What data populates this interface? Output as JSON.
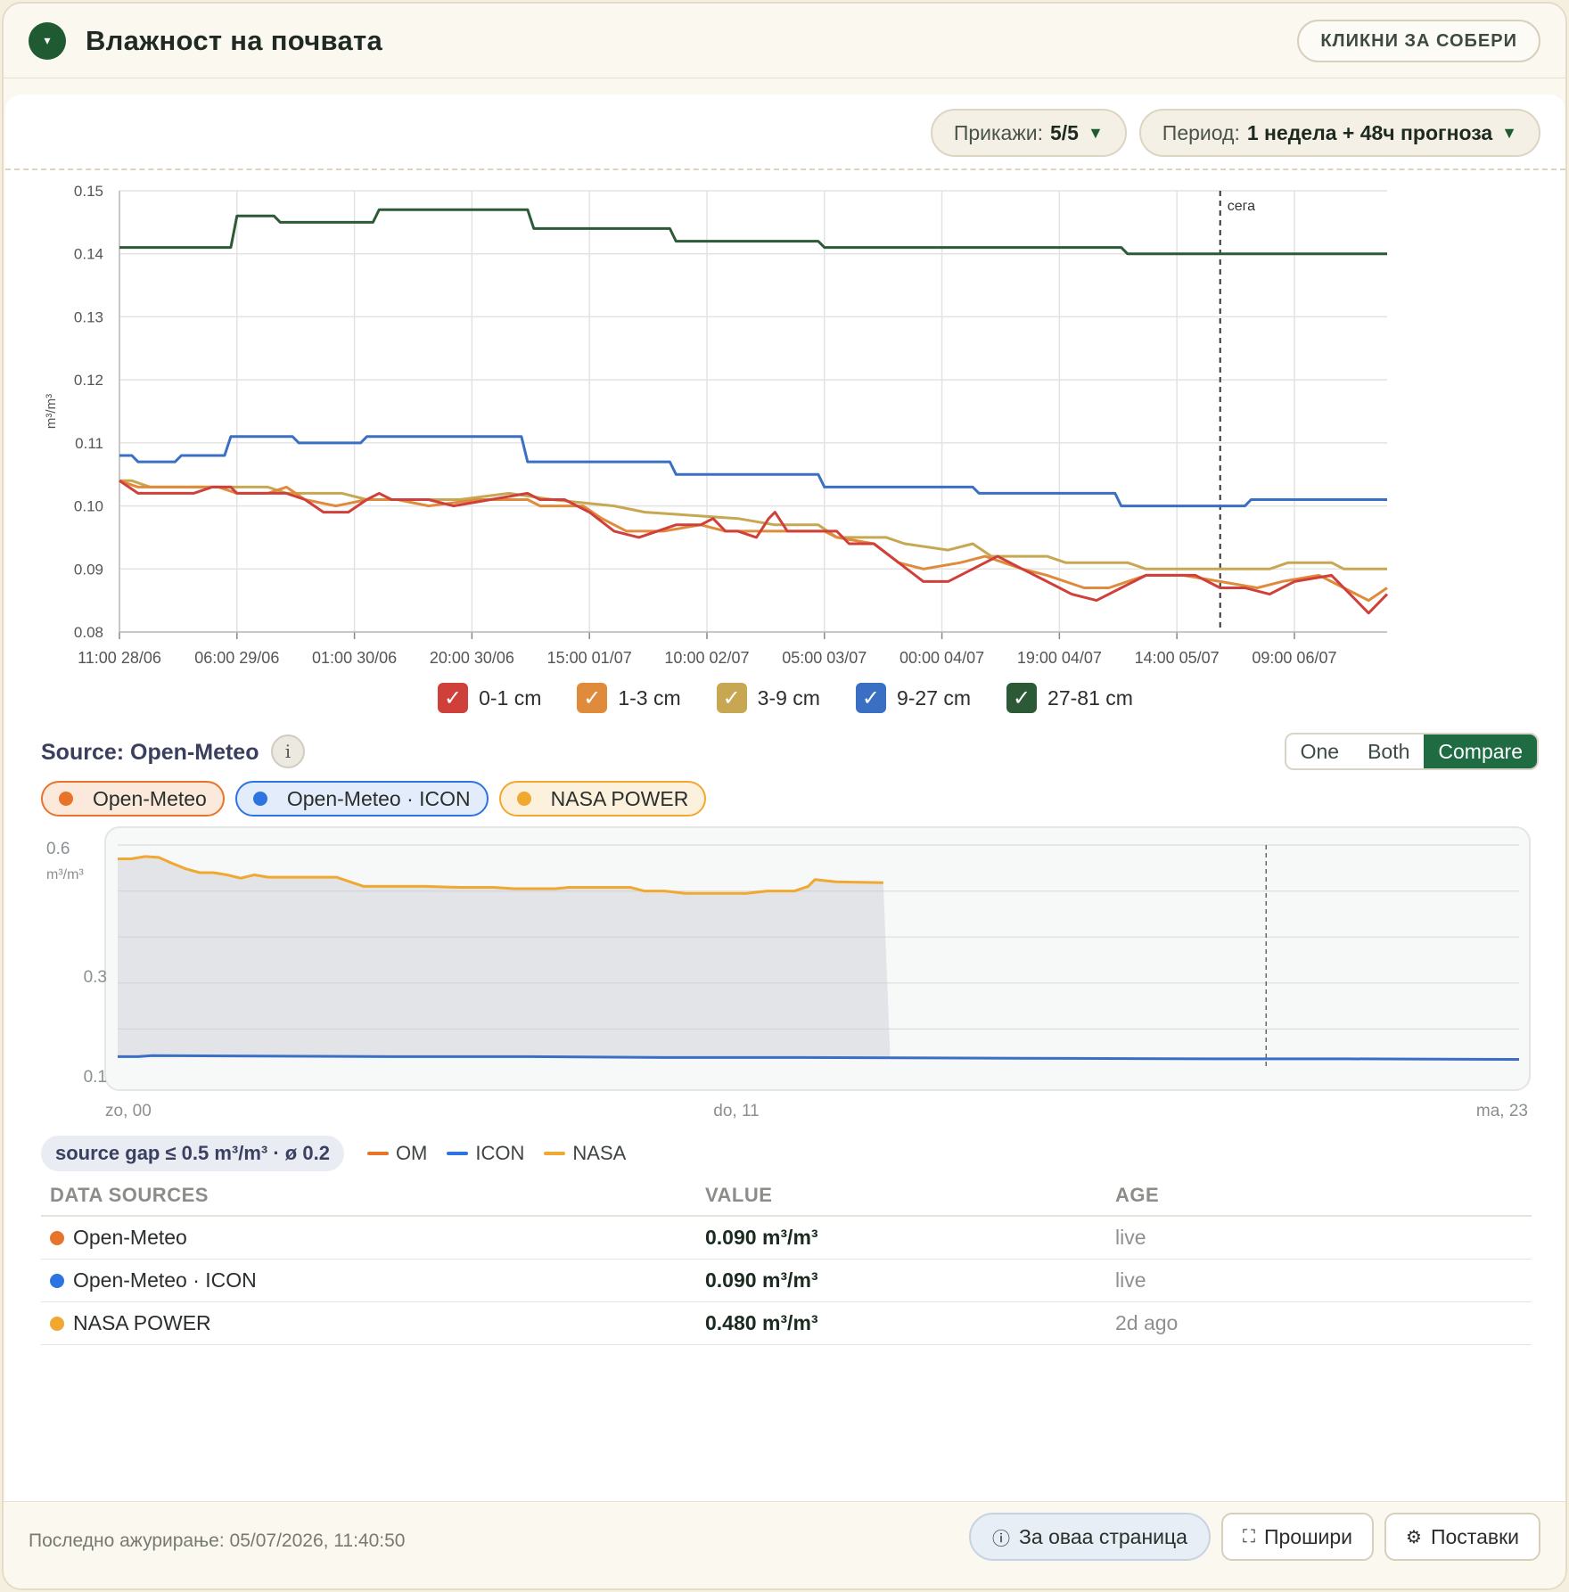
{
  "header": {
    "title": "Влажност на почвата",
    "collapse_label": "КЛИКНИ ЗА СОБЕРИ",
    "toggle_glyph": "▾"
  },
  "toolbar": {
    "show_label": "Прикажи:",
    "show_value": "5/5",
    "period_label": "Период:",
    "period_value": "1 недела + 48ч прогноза",
    "caret": "▼"
  },
  "chart_data": [
    {
      "type": "line",
      "ylabel": "m³/m³",
      "ylim": [
        0.08,
        0.15
      ],
      "yticks": [
        "0.15",
        "0.14",
        "0.13",
        "0.12",
        "0.11",
        "0.10",
        "0.09",
        "0.08"
      ],
      "xticks": [
        "11:00 28/06",
        "06:00 29/06",
        "01:00 30/06",
        "20:00 30/06",
        "15:00 01/07",
        "10:00 02/07",
        "05:00 03/07",
        "00:00 04/07",
        "19:00 04/07",
        "14:00 05/07",
        "09:00 06/07"
      ],
      "x_hours_per_tick": 19,
      "x_total_hours": 205,
      "now_hour": 178,
      "now_label": "сега",
      "series": [
        {
          "name": "27-81 cm",
          "color": "#2d5a36",
          "points": [
            [
              0,
              0.141
            ],
            [
              18,
              0.141
            ],
            [
              19,
              0.146
            ],
            [
              25,
              0.146
            ],
            [
              26,
              0.145
            ],
            [
              41,
              0.145
            ],
            [
              42,
              0.147
            ],
            [
              66,
              0.147
            ],
            [
              67,
              0.144
            ],
            [
              89,
              0.144
            ],
            [
              90,
              0.142
            ],
            [
              113,
              0.142
            ],
            [
              114,
              0.141
            ],
            [
              162,
              0.141
            ],
            [
              163,
              0.14
            ],
            [
              205,
              0.14
            ]
          ]
        },
        {
          "name": "9-27 cm",
          "color": "#3a6fc4",
          "points": [
            [
              0,
              0.108
            ],
            [
              2,
              0.108
            ],
            [
              3,
              0.107
            ],
            [
              9,
              0.107
            ],
            [
              10,
              0.108
            ],
            [
              17,
              0.108
            ],
            [
              18,
              0.111
            ],
            [
              28,
              0.111
            ],
            [
              29,
              0.11
            ],
            [
              39,
              0.11
            ],
            [
              40,
              0.111
            ],
            [
              65,
              0.111
            ],
            [
              66,
              0.107
            ],
            [
              89,
              0.107
            ],
            [
              90,
              0.105
            ],
            [
              113,
              0.105
            ],
            [
              114,
              0.103
            ],
            [
              138,
              0.103
            ],
            [
              139,
              0.102
            ],
            [
              161,
              0.102
            ],
            [
              162,
              0.1
            ],
            [
              179,
              0.1
            ],
            [
              180,
              0.1
            ],
            [
              182,
              0.1
            ],
            [
              183,
              0.101
            ],
            [
              205,
              0.101
            ]
          ]
        },
        {
          "name": "3-9 cm",
          "color": "#c8a752",
          "points": [
            [
              0,
              0.104
            ],
            [
              2,
              0.104
            ],
            [
              5,
              0.103
            ],
            [
              24,
              0.103
            ],
            [
              27,
              0.102
            ],
            [
              36,
              0.102
            ],
            [
              40,
              0.101
            ],
            [
              48,
              0.101
            ],
            [
              55,
              0.101
            ],
            [
              63,
              0.102
            ],
            [
              70,
              0.101
            ],
            [
              80,
              0.1
            ],
            [
              85,
              0.099
            ],
            [
              100,
              0.098
            ],
            [
              106,
              0.097
            ],
            [
              113,
              0.097
            ],
            [
              116,
              0.095
            ],
            [
              124,
              0.095
            ],
            [
              127,
              0.094
            ],
            [
              134,
              0.093
            ],
            [
              138,
              0.094
            ],
            [
              141,
              0.092
            ],
            [
              150,
              0.092
            ],
            [
              153,
              0.091
            ],
            [
              163,
              0.091
            ],
            [
              166,
              0.09
            ],
            [
              178,
              0.09
            ],
            [
              186,
              0.09
            ],
            [
              189,
              0.091
            ],
            [
              196,
              0.091
            ],
            [
              198,
              0.09
            ],
            [
              205,
              0.09
            ]
          ]
        },
        {
          "name": "1-3 cm",
          "color": "#e08a3c",
          "points": [
            [
              0,
              0.104
            ],
            [
              3,
              0.103
            ],
            [
              12,
              0.103
            ],
            [
              16,
              0.103
            ],
            [
              19,
              0.102
            ],
            [
              24,
              0.102
            ],
            [
              27,
              0.103
            ],
            [
              30,
              0.101
            ],
            [
              35,
              0.1
            ],
            [
              40,
              0.101
            ],
            [
              45,
              0.101
            ],
            [
              50,
              0.1
            ],
            [
              58,
              0.101
            ],
            [
              66,
              0.101
            ],
            [
              68,
              0.1
            ],
            [
              75,
              0.1
            ],
            [
              78,
              0.098
            ],
            [
              82,
              0.096
            ],
            [
              88,
              0.096
            ],
            [
              94,
              0.097
            ],
            [
              98,
              0.096
            ],
            [
              104,
              0.096
            ],
            [
              108,
              0.096
            ],
            [
              114,
              0.096
            ],
            [
              116,
              0.095
            ],
            [
              122,
              0.094
            ],
            [
              126,
              0.091
            ],
            [
              130,
              0.09
            ],
            [
              136,
              0.091
            ],
            [
              140,
              0.092
            ],
            [
              146,
              0.09
            ],
            [
              150,
              0.089
            ],
            [
              156,
              0.087
            ],
            [
              160,
              0.087
            ],
            [
              166,
              0.089
            ],
            [
              172,
              0.089
            ],
            [
              178,
              0.088
            ],
            [
              184,
              0.087
            ],
            [
              188,
              0.088
            ],
            [
              194,
              0.089
            ],
            [
              198,
              0.087
            ],
            [
              202,
              0.085
            ],
            [
              205,
              0.087
            ]
          ]
        },
        {
          "name": "0-1 cm",
          "color": "#d0403a",
          "points": [
            [
              0,
              0.104
            ],
            [
              3,
              0.102
            ],
            [
              12,
              0.102
            ],
            [
              15,
              0.103
            ],
            [
              18,
              0.103
            ],
            [
              19,
              0.102
            ],
            [
              24,
              0.102
            ],
            [
              27,
              0.102
            ],
            [
              30,
              0.101
            ],
            [
              33,
              0.099
            ],
            [
              37,
              0.099
            ],
            [
              40,
              0.101
            ],
            [
              42,
              0.102
            ],
            [
              44,
              0.101
            ],
            [
              50,
              0.101
            ],
            [
              54,
              0.1
            ],
            [
              60,
              0.101
            ],
            [
              66,
              0.102
            ],
            [
              68,
              0.101
            ],
            [
              72,
              0.101
            ],
            [
              76,
              0.099
            ],
            [
              80,
              0.096
            ],
            [
              84,
              0.095
            ],
            [
              90,
              0.097
            ],
            [
              94,
              0.097
            ],
            [
              96,
              0.098
            ],
            [
              98,
              0.096
            ],
            [
              100,
              0.096
            ],
            [
              103,
              0.095
            ],
            [
              105,
              0.098
            ],
            [
              106,
              0.099
            ],
            [
              108,
              0.096
            ],
            [
              112,
              0.096
            ],
            [
              116,
              0.096
            ],
            [
              118,
              0.094
            ],
            [
              122,
              0.094
            ],
            [
              126,
              0.091
            ],
            [
              130,
              0.088
            ],
            [
              134,
              0.088
            ],
            [
              138,
              0.09
            ],
            [
              142,
              0.092
            ],
            [
              146,
              0.09
            ],
            [
              150,
              0.088
            ],
            [
              154,
              0.086
            ],
            [
              158,
              0.085
            ],
            [
              162,
              0.087
            ],
            [
              166,
              0.089
            ],
            [
              170,
              0.089
            ],
            [
              174,
              0.089
            ],
            [
              178,
              0.087
            ],
            [
              182,
              0.087
            ],
            [
              186,
              0.086
            ],
            [
              190,
              0.088
            ],
            [
              196,
              0.089
            ],
            [
              200,
              0.085
            ],
            [
              202,
              0.083
            ],
            [
              205,
              0.086
            ]
          ]
        }
      ]
    },
    {
      "type": "line",
      "ylabel": "m³/m³",
      "ylim": [
        0.1,
        0.6
      ],
      "yticks": [
        "0.6",
        "0.3",
        "0.1"
      ],
      "xticks": [
        "zo, 00",
        "do, 11",
        "ma, 23"
      ],
      "x_total_hours": 205,
      "now_hour": 168,
      "series": [
        {
          "name": "NASA",
          "color": "#f0a830",
          "points": [
            [
              0,
              0.57
            ],
            [
              2,
              0.57
            ],
            [
              4,
              0.575
            ],
            [
              6,
              0.573
            ],
            [
              8,
              0.56
            ],
            [
              10,
              0.548
            ],
            [
              12,
              0.54
            ],
            [
              14,
              0.54
            ],
            [
              16,
              0.535
            ],
            [
              18,
              0.528
            ],
            [
              20,
              0.535
            ],
            [
              22,
              0.53
            ],
            [
              32,
              0.53
            ],
            [
              34,
              0.52
            ],
            [
              36,
              0.51
            ],
            [
              45,
              0.51
            ],
            [
              50,
              0.508
            ],
            [
              55,
              0.508
            ],
            [
              58,
              0.505
            ],
            [
              64,
              0.505
            ],
            [
              66,
              0.508
            ],
            [
              75,
              0.508
            ],
            [
              77,
              0.5
            ],
            [
              80,
              0.5
            ],
            [
              83,
              0.495
            ],
            [
              92,
              0.495
            ],
            [
              95,
              0.5
            ],
            [
              99,
              0.5
            ],
            [
              101,
              0.51
            ],
            [
              102,
              0.525
            ],
            [
              105,
              0.52
            ],
            [
              112,
              0.518
            ]
          ]
        },
        {
          "name": "ICON",
          "color": "#3a6fc4",
          "points": [
            [
              0,
              0.14
            ],
            [
              3,
              0.14
            ],
            [
              5,
              0.142
            ],
            [
              20,
              0.141
            ],
            [
              40,
              0.14
            ],
            [
              60,
              0.14
            ],
            [
              80,
              0.138
            ],
            [
              100,
              0.138
            ],
            [
              120,
              0.137
            ],
            [
              140,
              0.136
            ],
            [
              160,
              0.135
            ],
            [
              180,
              0.135
            ],
            [
              205,
              0.134
            ]
          ]
        }
      ]
    }
  ],
  "legend": [
    {
      "label": "0-1 cm",
      "color": "#d0403a"
    },
    {
      "label": "1-3 cm",
      "color": "#e08a3c"
    },
    {
      "label": "3-9 cm",
      "color": "#c8a752"
    },
    {
      "label": "9-27 cm",
      "color": "#3a6fc4"
    },
    {
      "label": "27-81 cm",
      "color": "#2d5a36"
    }
  ],
  "source": {
    "title": "Source: Open-Meteo",
    "info_glyph": "i",
    "modes": [
      "One",
      "Both",
      "Compare"
    ],
    "active_mode": "Compare",
    "pills": [
      {
        "label": "Open-Meteo",
        "color": "#e8742c",
        "bg": "#fbe9dc",
        "border": "#e8742c"
      },
      {
        "label": "Open-Meteo · ICON",
        "color": "#2d74e0",
        "bg": "#e3ecfb",
        "border": "#2d74e0"
      },
      {
        "label": "NASA POWER",
        "color": "#f0a830",
        "bg": "#fcf1dc",
        "border": "#f0a830"
      }
    ]
  },
  "gap": {
    "badge": "source gap ≤ 0.5 m³/m³ · ø 0.2",
    "legend": [
      {
        "label": "OM",
        "color": "#e8742c"
      },
      {
        "label": "ICON",
        "color": "#2d74e0"
      },
      {
        "label": "NASA",
        "color": "#f0a830"
      }
    ]
  },
  "table": {
    "headers": [
      "DATA SOURCES",
      "VALUE",
      "AGE"
    ],
    "rows": [
      {
        "name": "Open-Meteo",
        "color": "#e8742c",
        "value": "0.090 m³/m³",
        "age": "live"
      },
      {
        "name": "Open-Meteo · ICON",
        "color": "#2d74e0",
        "value": "0.090 m³/m³",
        "age": "live"
      },
      {
        "name": "NASA POWER",
        "color": "#f0a830",
        "value": "0.480 m³/m³",
        "age": "2d ago"
      }
    ]
  },
  "footer": {
    "updated": "Последно ажурирање: 05/07/2026, 11:40:50",
    "about_label": "За оваа страница",
    "expand_label": "Прошири",
    "settings_label": "Поставки",
    "about_icon": "ⓘ",
    "expand_icon": "⛶",
    "settings_icon": "⚙"
  }
}
